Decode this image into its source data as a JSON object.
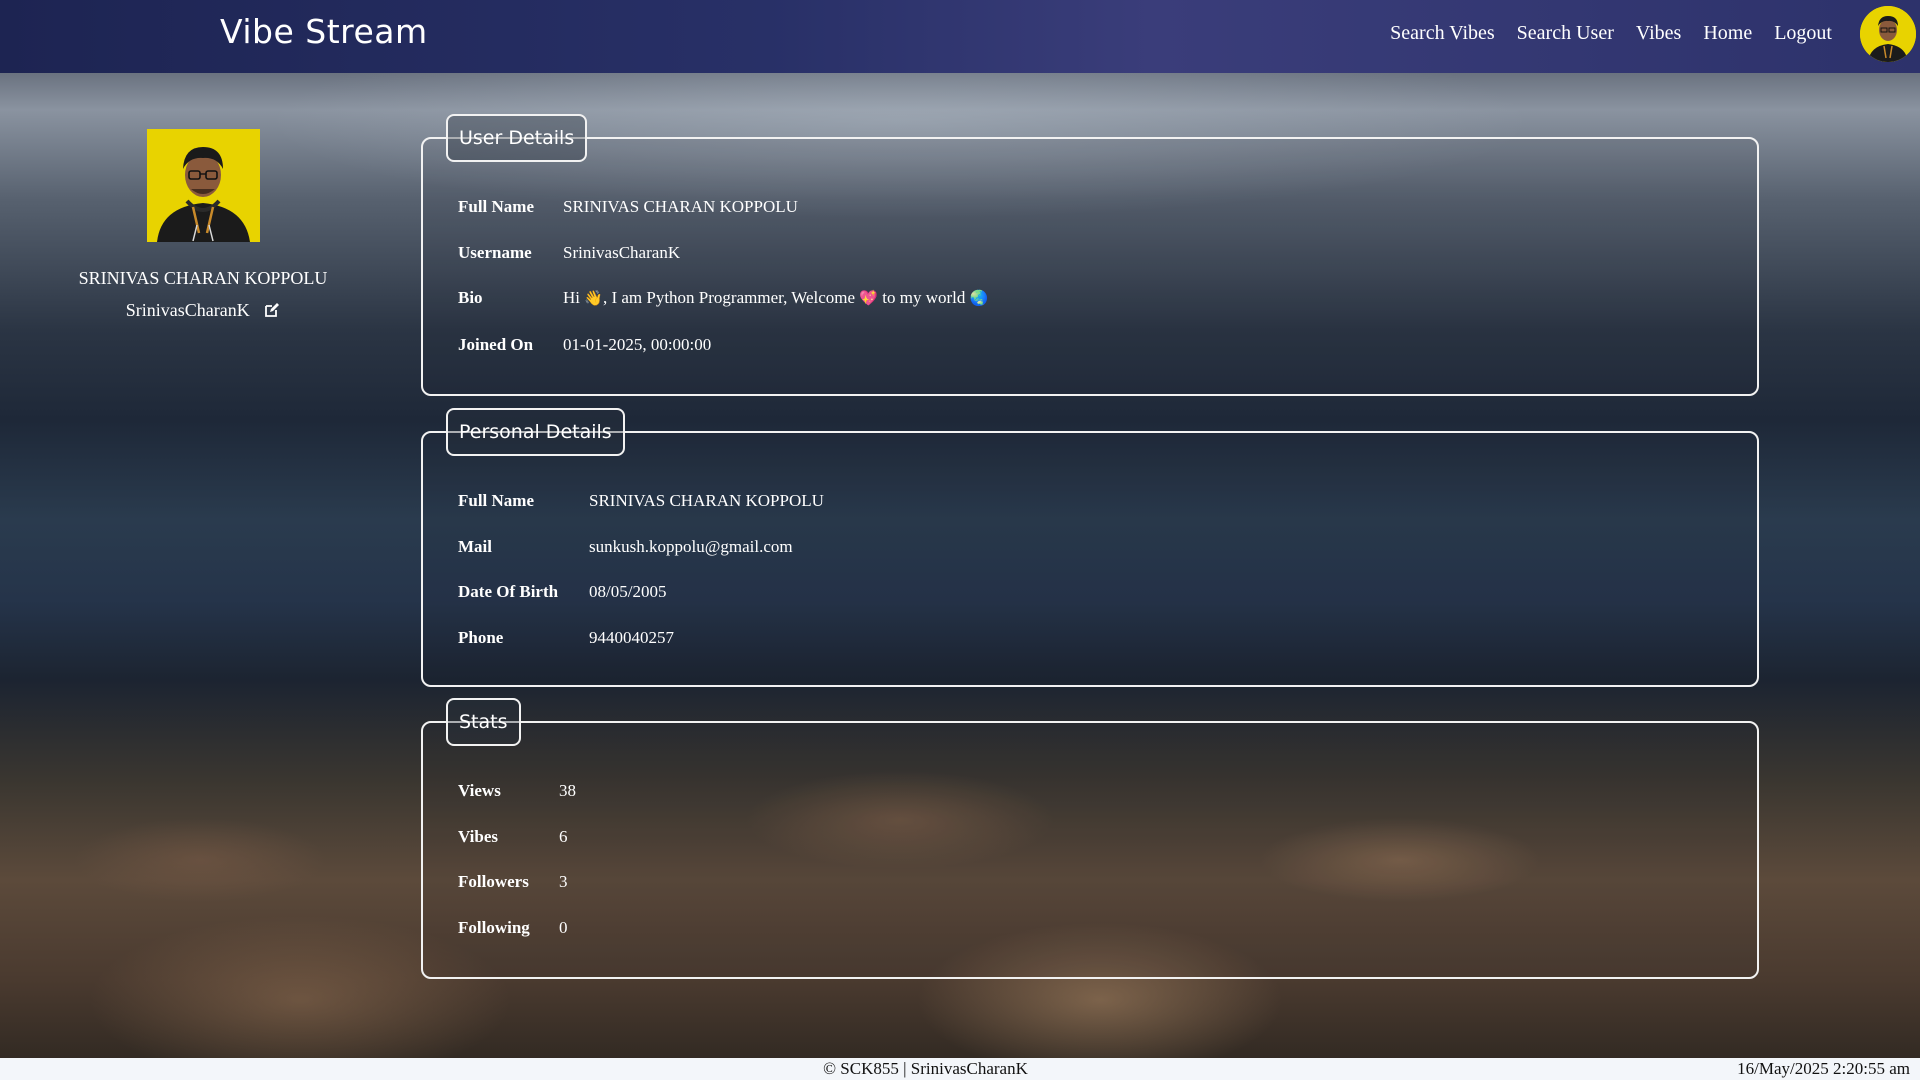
{
  "header": {
    "brand": "Vibe Stream",
    "nav": [
      "Search Vibes",
      "Search User",
      "Vibes",
      "Home",
      "Logout"
    ]
  },
  "profile": {
    "full_name": "SRINIVAS CHARAN KOPPOLU",
    "username": "SrinivasCharanK"
  },
  "user_details": {
    "title": "User Details",
    "full_name_label": "Full Name",
    "full_name": "SRINIVAS CHARAN KOPPOLU",
    "username_label": "Username",
    "username": "SrinivasCharanK",
    "bio_label": "Bio",
    "bio_part1": "Hi",
    "bio_part2": ", I am Python Programmer, Welcome",
    "bio_part3": "to my world",
    "joined_label": "Joined On",
    "joined": "01-01-2025, 00:00:00"
  },
  "personal_details": {
    "title": "Personal Details",
    "full_name_label": "Full Name",
    "full_name": "SRINIVAS CHARAN KOPPOLU",
    "mail_label": "Mail",
    "mail": "sunkush.koppolu@gmail.com",
    "dob_label": "Date Of Birth",
    "dob": "08/05/2005",
    "phone_label": "Phone",
    "phone": "9440040257"
  },
  "stats": {
    "title": "Stats",
    "views_label": "Views",
    "views": "38",
    "vibes_label": "Vibes",
    "vibes": "6",
    "followers_label": "Followers",
    "followers": "3",
    "following_label": "Following",
    "following": "0"
  },
  "footer": {
    "copyright": "© SCK855 | SrinivasCharanK",
    "datetime": "16/May/2025 2:20:55 am"
  }
}
